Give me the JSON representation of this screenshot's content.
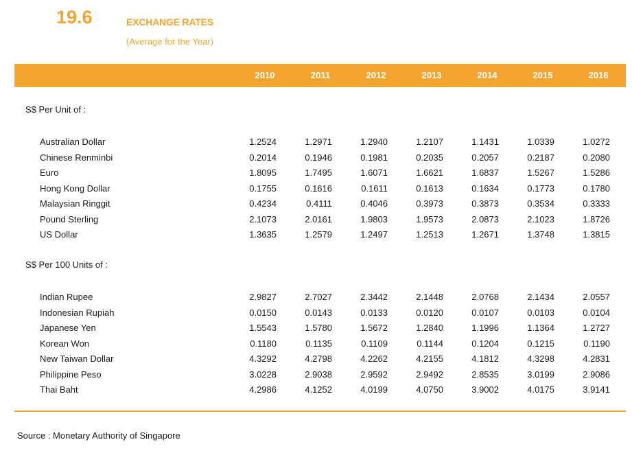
{
  "table_number": "19.6",
  "title": "EXCHANGE RATES",
  "subtitle": "(Average for the Year)",
  "years": [
    "2010",
    "2011",
    "2012",
    "2013",
    "2014",
    "2015",
    "2016"
  ],
  "sections": [
    {
      "heading": "S$ Per Unit of :",
      "rows": [
        {
          "label": "Australian Dollar",
          "values": [
            "1.2524",
            "1.2971",
            "1.2940",
            "1.2107",
            "1.1431",
            "1.0339",
            "1.0272"
          ]
        },
        {
          "label": "Chinese Renminbi",
          "values": [
            "0.2014",
            "0.1946",
            "0.1981",
            "0.2035",
            "0.2057",
            "0.2187",
            "0.2080"
          ]
        },
        {
          "label": "Euro",
          "values": [
            "1.8095",
            "1.7495",
            "1.6071",
            "1.6621",
            "1.6837",
            "1.5267",
            "1.5286"
          ]
        },
        {
          "label": "Hong Kong Dollar",
          "values": [
            "0.1755",
            "0.1616",
            "0.1611",
            "0.1613",
            "0.1634",
            "0.1773",
            "0.1780"
          ]
        },
        {
          "label": "Malaysian Ringgit",
          "values": [
            "0.4234",
            "0.4111",
            "0.4046",
            "0.3973",
            "0.3873",
            "0.3534",
            "0.3333"
          ]
        },
        {
          "label": "Pound Sterling",
          "values": [
            "2.1073",
            "2.0161",
            "1.9803",
            "1.9573",
            "2.0873",
            "2.1023",
            "1.8726"
          ]
        },
        {
          "label": "US Dollar",
          "values": [
            "1.3635",
            "1.2579",
            "1.2497",
            "1.2513",
            "1.2671",
            "1.3748",
            "1.3815"
          ]
        }
      ]
    },
    {
      "heading": "S$ Per 100 Units of :",
      "rows": [
        {
          "label": "Indian Rupee",
          "values": [
            "2.9827",
            "2.7027",
            "2.3442",
            "2.1448",
            "2.0768",
            "2.1434",
            "2.0557"
          ]
        },
        {
          "label": "Indonesian Rupiah",
          "values": [
            "0.0150",
            "0.0143",
            "0.0133",
            "0.0120",
            "0.0107",
            "0.0103",
            "0.0104"
          ]
        },
        {
          "label": "Japanese Yen",
          "values": [
            "1.5543",
            "1.5780",
            "1.5672",
            "1.2840",
            "1.1996",
            "1.1364",
            "1.2727"
          ]
        },
        {
          "label": "Korean Won",
          "values": [
            "0.1180",
            "0.1135",
            "0.1109",
            "0.1144",
            "0.1204",
            "0.1215",
            "0.1190"
          ]
        },
        {
          "label": "New Taiwan Dollar",
          "values": [
            "4.3292",
            "4.2798",
            "4.2262",
            "4.2155",
            "4.1812",
            "4.3298",
            "4.2831"
          ]
        },
        {
          "label": "Philippine Peso",
          "values": [
            "3.0228",
            "2.9038",
            "2.9592",
            "2.9492",
            "2.8535",
            "3.0199",
            "2.9086"
          ]
        },
        {
          "label": "Thai Baht",
          "values": [
            "4.2986",
            "4.1252",
            "4.0199",
            "4.0750",
            "3.9002",
            "4.0175",
            "3.9141"
          ]
        }
      ]
    }
  ],
  "source": "Source : Monetary Authority of Singapore"
}
